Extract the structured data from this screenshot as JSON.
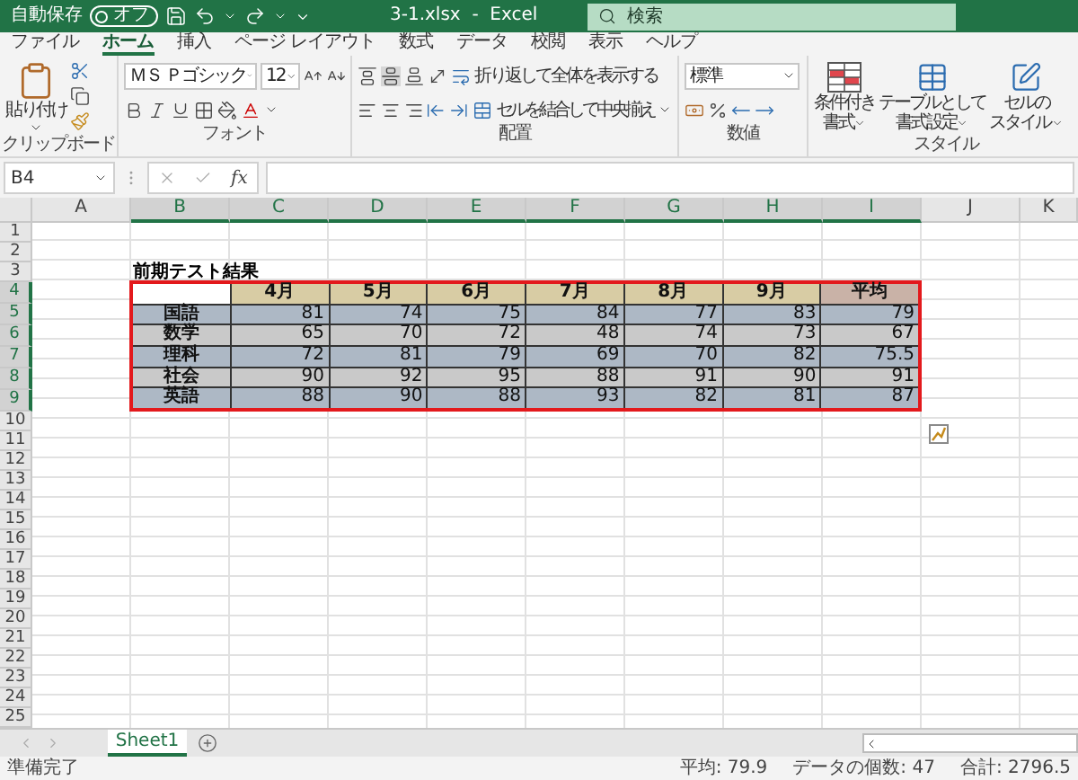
{
  "title_bar": {
    "autosave_label": "自動保存",
    "autosave_toggle": {
      "label": "オフ",
      "on": false
    },
    "file_name": "3-1.xlsx  -  Excel",
    "search": {
      "placeholder": "検索"
    }
  },
  "menu_tabs": [
    {
      "label": "ファイル",
      "selected": false
    },
    {
      "label": "ホーム",
      "selected": true
    },
    {
      "label": "挿入",
      "selected": false
    },
    {
      "label": "ページ レイアウト",
      "selected": false
    },
    {
      "label": "数式",
      "selected": false
    },
    {
      "label": "データ",
      "selected": false
    },
    {
      "label": "校閲",
      "selected": false
    },
    {
      "label": "表示",
      "selected": false
    },
    {
      "label": "ヘルプ",
      "selected": false
    }
  ],
  "ribbon": {
    "clipboard": {
      "paste_label": "貼り付け",
      "group_label": "クリップボード"
    },
    "font": {
      "font_name": "ＭＳ Ｐゴシック",
      "font_size": "12",
      "group_label": "フォント"
    },
    "alignment": {
      "wrap_text": "折り返して全体を表示する",
      "merge_center": "セルを結合して中央揃え",
      "group_label": "配置"
    },
    "number": {
      "format": "標準",
      "group_label": "数値"
    },
    "styles": {
      "group_label": "スタイル",
      "buttons": [
        {
          "kind": "conditional",
          "line_1": "条件付き",
          "line_2": "書式"
        },
        {
          "kind": "table",
          "line_1": "テーブルとして",
          "line_2": "書式設定"
        },
        {
          "kind": "cell",
          "line_1": "セルの",
          "line_2": "スタイル"
        }
      ]
    }
  },
  "formula_bar": {
    "name_box": "B4",
    "function_label": "fx"
  },
  "sheet": {
    "columns": [
      {
        "label": "A",
        "selected": false
      },
      {
        "label": "B",
        "selected": true
      },
      {
        "label": "C",
        "selected": true
      },
      {
        "label": "D",
        "selected": true
      },
      {
        "label": "E",
        "selected": true
      },
      {
        "label": "F",
        "selected": true
      },
      {
        "label": "G",
        "selected": true
      },
      {
        "label": "H",
        "selected": true
      },
      {
        "label": "I",
        "selected": true
      },
      {
        "label": "J",
        "selected": false
      },
      {
        "label": "K",
        "selected": false
      }
    ],
    "rows": [
      {
        "label": "1",
        "selected": false
      },
      {
        "label": "2",
        "selected": false
      },
      {
        "label": "3",
        "selected": false
      },
      {
        "label": "4",
        "selected": true
      },
      {
        "label": "5",
        "selected": true
      },
      {
        "label": "6",
        "selected": true
      },
      {
        "label": "7",
        "selected": true
      },
      {
        "label": "8",
        "selected": true
      },
      {
        "label": "9",
        "selected": true
      },
      {
        "label": "10",
        "selected": false
      },
      {
        "label": "11",
        "selected": false
      },
      {
        "label": "12",
        "selected": false
      },
      {
        "label": "13",
        "selected": false
      },
      {
        "label": "14",
        "selected": false
      },
      {
        "label": "15",
        "selected": false
      },
      {
        "label": "16",
        "selected": false
      },
      {
        "label": "17",
        "selected": false
      },
      {
        "label": "18",
        "selected": false
      },
      {
        "label": "19",
        "selected": false
      },
      {
        "label": "20",
        "selected": false
      },
      {
        "label": "21",
        "selected": false
      },
      {
        "label": "22",
        "selected": false
      },
      {
        "label": "23",
        "selected": false
      },
      {
        "label": "24",
        "selected": false
      },
      {
        "label": "25",
        "selected": false
      }
    ],
    "title": "前期テスト結果",
    "table": {
      "columns": [
        {
          "label": "4月",
          "kind": "month"
        },
        {
          "label": "5月",
          "kind": "month"
        },
        {
          "label": "6月",
          "kind": "month"
        },
        {
          "label": "7月",
          "kind": "month"
        },
        {
          "label": "8月",
          "kind": "month"
        },
        {
          "label": "9月",
          "kind": "month"
        },
        {
          "label": "平均",
          "kind": "average"
        }
      ],
      "rows": [
        {
          "label": "国語",
          "values": [
            "81",
            "74",
            "75",
            "84",
            "77",
            "83",
            "79"
          ]
        },
        {
          "label": "数学",
          "values": [
            "65",
            "70",
            "72",
            "48",
            "74",
            "73",
            "67"
          ]
        },
        {
          "label": "理科",
          "values": [
            "72",
            "81",
            "79",
            "69",
            "70",
            "82",
            "75.5"
          ]
        },
        {
          "label": "社会",
          "values": [
            "90",
            "92",
            "95",
            "88",
            "91",
            "90",
            "91"
          ]
        },
        {
          "label": "英語",
          "values": [
            "88",
            "90",
            "88",
            "93",
            "82",
            "81",
            "87"
          ]
        }
      ]
    }
  },
  "sheet_tabs": [
    {
      "label": "Sheet1",
      "selected": true
    }
  ],
  "status_bar": {
    "mode": "準備完了",
    "average": "平均: 79.9",
    "count": "データの個数: 47",
    "sum": "合計: 2796.5"
  }
}
